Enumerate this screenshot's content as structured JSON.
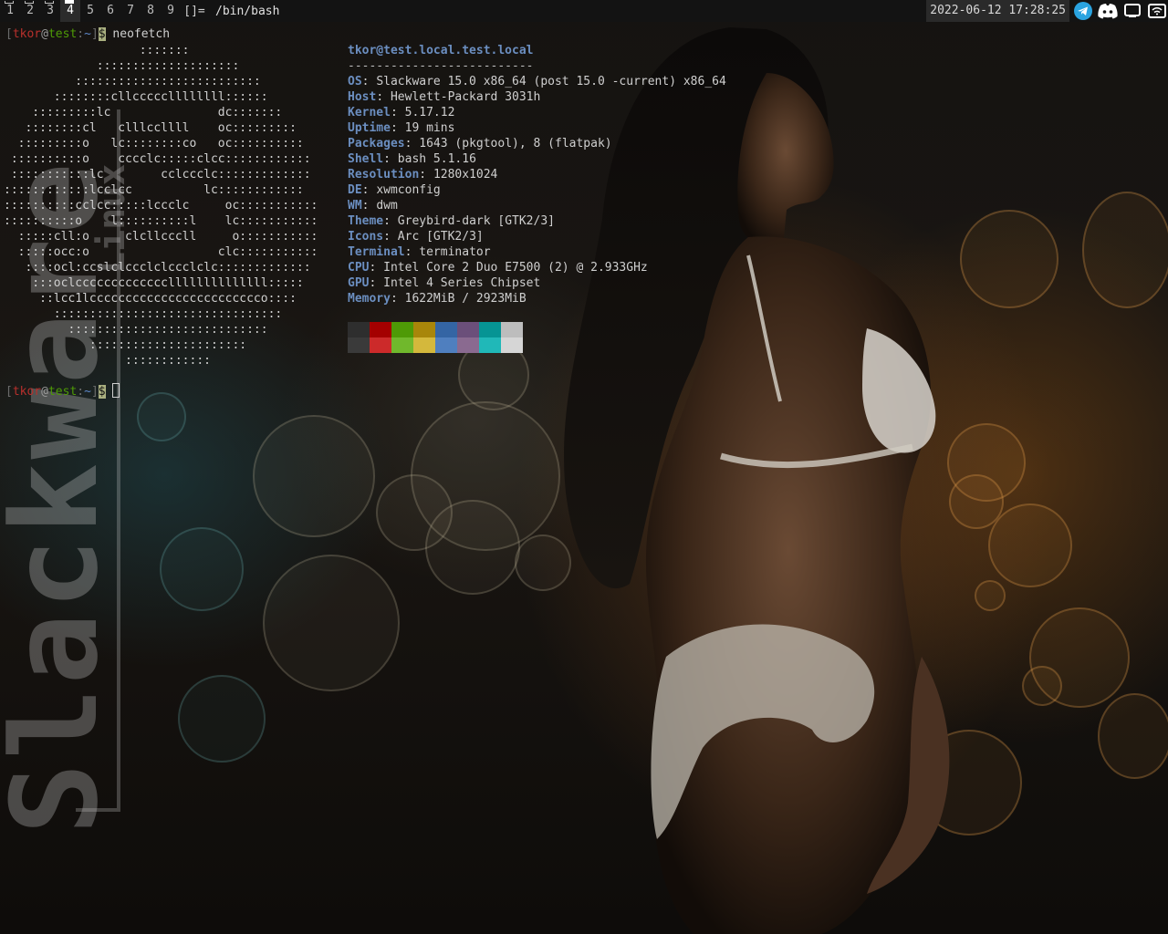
{
  "topbar": {
    "tags": [
      "1",
      "2",
      "3",
      "4",
      "5",
      "6",
      "7",
      "8",
      "9"
    ],
    "active_tag": "4",
    "layout_symbol": "[]=",
    "window_title": "/bin/bash",
    "clock": "2022-06-12 17:28:25",
    "tray_icons": [
      "telegram-icon",
      "discord-icon",
      "chat-window-icon",
      "wifi-icon"
    ],
    "colors": {
      "bar_bg": "#131313",
      "active_tag_bg": "#2b2b2b",
      "clock_bg": "#2a2a2a",
      "telegram": "#2aa3e0"
    }
  },
  "terminal": {
    "prompt": {
      "open": "[",
      "user": "tkor",
      "at": "@",
      "host": "test",
      "sep": ":",
      "path": "~",
      "close": "]",
      "dollar": "$"
    },
    "command": "neofetch",
    "ascii_art": [
      "                   :::::::",
      "             ::::::::::::::::::::",
      "          ::::::::::::::::::::::::::",
      "       ::::::::cllcccccllllllll::::::",
      "    :::::::::lc               dc:::::::",
      "   ::::::::cl   clllccllll    oc:::::::::",
      "  :::::::::o   lc::::::::co   oc::::::::::",
      " ::::::::::o    cccclc:::::clcc::::::::::::",
      " :::::::::::lc        cclccclc:::::::::::::",
      "::::::::::::lcclcc          lc::::::::::::",
      "::::::::::cclcc:::::lccclc     oc:::::::::::",
      "::::::::::o    l::::::::::l    lc:::::::::::",
      "  :::::cll:o     clcllcccll     o:::::::::::",
      "  :::::occ:o                  clc:::::::::::",
      "   ::::ocl:ccslclccclclccclclc:::::::::::::",
      "    :::oclcccccccccccccllllllllllllll:::::",
      "     ::lcc1lcccccccccccccccccccccccco::::",
      "       ::::::::::::::::::::::::::::::::",
      "         ::::::::::::::::::::::::::::",
      "            ::::::::::::::::::::::",
      "                 ::::::::::::"
    ],
    "info": {
      "header": "tkor@test.local.test.local",
      "separator": "--------------------------",
      "rows": [
        {
          "key": "OS",
          "value": "Slackware 15.0 x86_64 (post 15.0 -current) x86_64"
        },
        {
          "key": "Host",
          "value": "Hewlett-Packard 3031h"
        },
        {
          "key": "Kernel",
          "value": "5.17.12"
        },
        {
          "key": "Uptime",
          "value": "19 mins"
        },
        {
          "key": "Packages",
          "value": "1643 (pkgtool), 8 (flatpak)"
        },
        {
          "key": "Shell",
          "value": "bash 5.1.16"
        },
        {
          "key": "Resolution",
          "value": "1280x1024"
        },
        {
          "key": "DE",
          "value": "xwmconfig"
        },
        {
          "key": "WM",
          "value": "dwm"
        },
        {
          "key": "Theme",
          "value": "Greybird-dark [GTK2/3]"
        },
        {
          "key": "Icons",
          "value": "Arc [GTK2/3]"
        },
        {
          "key": "Terminal",
          "value": "terminator"
        },
        {
          "key": "CPU",
          "value": "Intel Core 2 Duo E7500 (2) @ 2.933GHz"
        },
        {
          "key": "GPU",
          "value": "Intel 4 Series Chipset"
        },
        {
          "key": "Memory",
          "value": "1622MiB / 2923MiB"
        }
      ]
    },
    "palette": {
      "normal": [
        "#2e2e2e",
        "#a40000",
        "#4e9a06",
        "#a8860a",
        "#3465a4",
        "#6b4f7a",
        "#069494",
        "#bdbdbd"
      ],
      "bright": [
        "#3a3a3a",
        "#cc2a2a",
        "#70b82c",
        "#d4b83c",
        "#4f7fbf",
        "#8a6a90",
        "#20b8b8",
        "#d6d6d6"
      ]
    }
  },
  "wallpaper": {
    "logo_text": "Slackware",
    "logo_subtext": "Linux"
  }
}
